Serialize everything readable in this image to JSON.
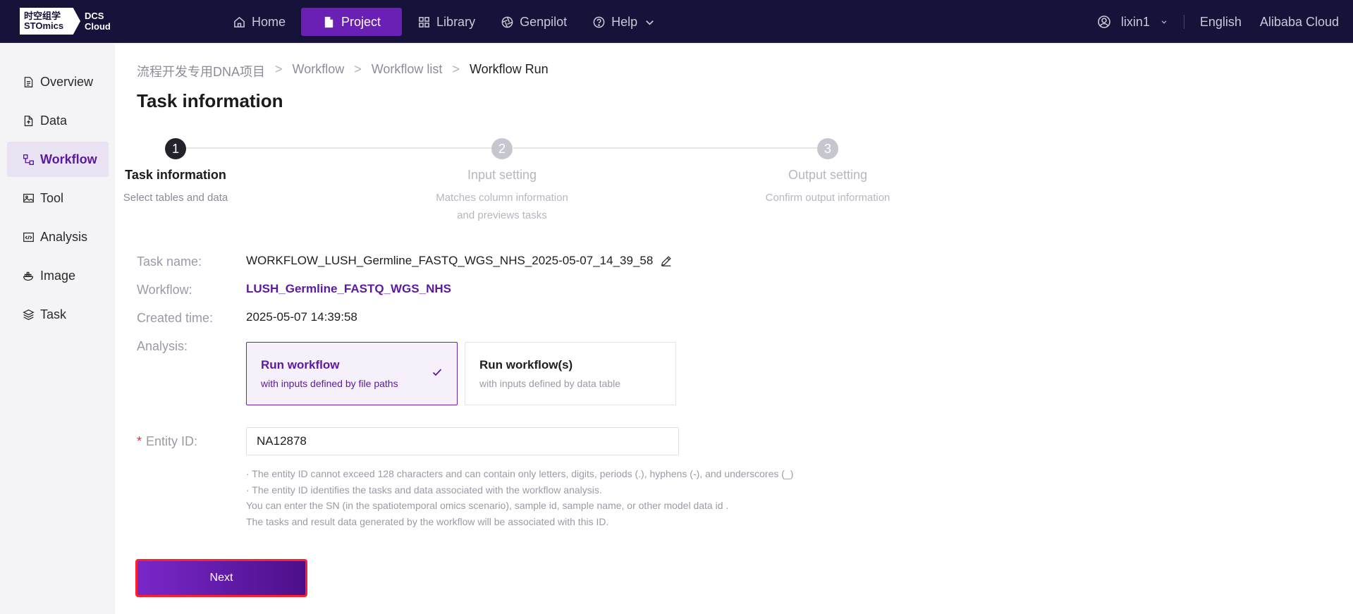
{
  "brand": {
    "logo_cn": "时空组学",
    "logo_en": "STOmics",
    "product_line1": "DCS",
    "product_line2": "Cloud"
  },
  "nav": {
    "items": [
      {
        "label": "Home",
        "icon": "home-icon"
      },
      {
        "label": "Project",
        "icon": "file-icon",
        "active": true
      },
      {
        "label": "Library",
        "icon": "grid-icon"
      },
      {
        "label": "Genpilot",
        "icon": "aperture-icon"
      },
      {
        "label": "Help",
        "icon": "help-icon"
      }
    ],
    "user": "lixin1",
    "language": "English",
    "cloud": "Alibaba Cloud"
  },
  "sidebar": {
    "items": [
      {
        "label": "Overview",
        "icon": "document-icon"
      },
      {
        "label": "Data",
        "icon": "file-upload-icon"
      },
      {
        "label": "Workflow",
        "icon": "workflow-icon",
        "active": true
      },
      {
        "label": "Tool",
        "icon": "image-tool-icon"
      },
      {
        "label": "Analysis",
        "icon": "code-icon"
      },
      {
        "label": "Image",
        "icon": "docker-icon"
      },
      {
        "label": "Task",
        "icon": "layers-icon"
      }
    ]
  },
  "breadcrumb": {
    "items": [
      "流程开发专用DNA项目",
      "Workflow",
      "Workflow list",
      "Workflow Run"
    ],
    "separator": ">"
  },
  "page": {
    "title": "Task information"
  },
  "steps": [
    {
      "number": "1",
      "title": "Task information",
      "desc_line1": "Select tables and data",
      "desc_line2": "",
      "active": true
    },
    {
      "number": "2",
      "title": "Input setting",
      "desc_line1": "Matches column information",
      "desc_line2": "and previews tasks",
      "active": false
    },
    {
      "number": "3",
      "title": "Output setting",
      "desc_line1": "Confirm output information",
      "desc_line2": "",
      "active": false
    }
  ],
  "form": {
    "task_name_label": "Task name:",
    "task_name_value": "WORKFLOW_LUSH_Germline_FASTQ_WGS_NHS_2025-05-07_14_39_58",
    "workflow_label": "Workflow:",
    "workflow_value": "LUSH_Germline_FASTQ_WGS_NHS",
    "created_label": "Created time:",
    "created_value": "2025-05-07 14:39:58",
    "analysis_label": "Analysis:",
    "options": [
      {
        "title": "Run workflow",
        "desc": "with inputs defined by file paths",
        "selected": true
      },
      {
        "title": "Run workflow(s)",
        "desc": "with inputs defined by data table",
        "selected": false
      }
    ],
    "entity_label": "Entity  ID:",
    "entity_required": "*",
    "entity_value": "NA12878",
    "hints": [
      "· The entity ID cannot exceed 128 characters and can contain only letters, digits, periods (.), hyphens (-), and underscores (_)",
      "· The entity ID identifies the tasks and data associated with the workflow analysis.",
      "You can enter the SN (in the spatiotemporal omics scenario), sample id, sample name, or other model data id .",
      "The tasks and result data generated by the workflow will be associated with this ID."
    ]
  },
  "actions": {
    "next_label": "Next"
  },
  "colors": {
    "topbar": "#16123a",
    "accent": "#6a1fb5",
    "accent_dark": "#4c0f8a",
    "highlight_border": "#ff1f2e"
  }
}
